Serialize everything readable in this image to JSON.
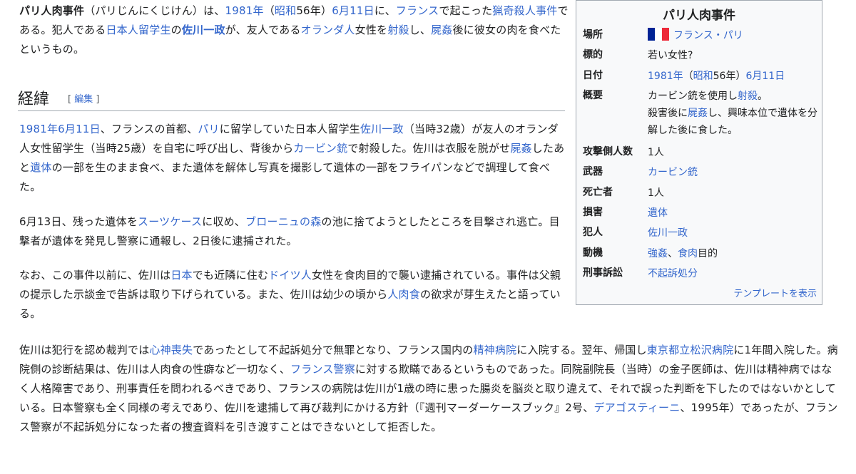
{
  "intro": {
    "bold_title": "パリ人肉事件",
    "reading": "（パリじんにくじけん）は、",
    "year_link": "1981年",
    "paren_open": "（",
    "era_link": "昭和",
    "era_year": "56年）",
    "date_link": "6月11日",
    "t1": "に、",
    "france_link": "フランス",
    "t2": "で起こった",
    "crime_link": "猟奇殺人事件",
    "t3": "である。犯人である",
    "student_link": "日本人留学生",
    "t4": "の",
    "culprit_link": "佐川一政",
    "t5": "が、友人である",
    "dutch_link": "オランダ人",
    "t6": "女性を",
    "shot_link": "射殺",
    "t7": "し、",
    "necro_link": "屍姦",
    "t8": "後に彼女の肉を食べたというもの。"
  },
  "section": {
    "title": "経緯",
    "edit_open": "[",
    "edit_label": "編集",
    "edit_close": "]"
  },
  "p1": {
    "date_link": "1981年6月11日",
    "a": "、フランスの首都、",
    "paris_link": "パリ",
    "b": "に留学していた日本人留学生",
    "sagawa_link": "佐川一政",
    "c": "（当時32歳）が友人のオランダ人女性留学生（当時25歳）を自宅に呼び出し、背後から",
    "carbine_link": "カービン銃",
    "d": "で射殺した。佐川は衣服を脱がせ",
    "necro_link": "屍姦",
    "e": "したあと",
    "corpse_link": "遺体",
    "f": "の一部を生のまま食べ、また遺体を解体し写真を撮影して遺体の一部をフライパンなどで調理して食べた。"
  },
  "p2": {
    "a": "6月13日、残った遺体を",
    "suitcase_link": "スーツケース",
    "b": "に収め、",
    "bois_link": "ブローニュの森",
    "c": "の池に捨てようとしたところを目撃され逃亡。目撃者が遺体を発見し警察に通報し、2日後に逮捕された。"
  },
  "p3": {
    "a": "なお、この事件以前に、佐川は",
    "japan_link": "日本",
    "b": "でも近隣に住む",
    "german_link": "ドイツ人",
    "c": "女性を食肉目的で襲い逮捕されている。事件は父親の提示した示談金で告訴は取り下げられている。また、佐川は幼少の頃から",
    "canni_link": "人肉食",
    "d": "の欲求が芽生えたと語っている。"
  },
  "p4": {
    "a": "佐川は犯行を認め裁判では",
    "insanity_link": "心神喪失",
    "b": "であったとして不起訴処分で無罪となり、フランス国内の",
    "hospital_link": "精神病院",
    "c": "に入院する。翌年、帰国し",
    "matsuzawa_link": "東京都立松沢病院",
    "d": "に1年間入院した。病院側の診断結果は、佐川は人肉食の性癖など一切なく、",
    "police_link": "フランス警察",
    "e": "に対する欺瞞であるというものであった。同院副院長（当時）の金子医師は、佐川は精神病ではなく人格障害であり、刑事責任を問われるべきであり、フランスの病院は佐川が1歳の時に患った腸炎を脳炎と取り違えて、それで誤った判断を下したのではないかとしている。日本警察も全く同様の考えであり、佐川を逮捕して再び裁判にかける方針（『週刊マーダーケースブック』2号、",
    "deagostini_link": "デアゴスティーニ",
    "f": "、1995年）であったが、フランス警察が不起訴処分になった者の捜査資料を引き渡すことはできないとして拒否した。"
  },
  "infobox": {
    "title": "パリ人肉事件",
    "place_label": "場所",
    "place_value": "フランス・パリ",
    "flag_colors": [
      "#002395",
      "#ffffff",
      "#ed2939"
    ],
    "target_label": "標的",
    "target_value": "若い女性?",
    "date_label": "日付",
    "date_year": "1981年",
    "date_open": "（",
    "date_era": "昭和",
    "date_era_year": "56年）",
    "date_day": "6月11日",
    "summary_label": "概要",
    "summary_a": "カービン銃を使用し",
    "summary_shot": "射殺",
    "summary_b": "。",
    "summary_c": "殺害後に",
    "summary_necro": "屍姦",
    "summary_d": "し、興味本位で遺体を分解した後に食した。",
    "attackers_label": "攻撃側人数",
    "attackers_value": "1人",
    "weapon_label": "武器",
    "weapon_value": "カービン銃",
    "dead_label": "死亡者",
    "dead_value": "1人",
    "damage_label": "損害",
    "damage_value": "遺体",
    "culprit_label": "犯人",
    "culprit_value": "佐川一政",
    "motive_label": "動機",
    "motive_a": "強姦",
    "motive_sep": "、",
    "motive_b": "食肉",
    "motive_c": "目的",
    "trial_label": "刑事訴訟",
    "trial_value": "不起訴処分",
    "template_link": "テンプレートを表示"
  },
  "colors": {
    "link": "#3366cc",
    "text": "#202122",
    "infobox_bg": "#f8f9fa",
    "border": "#a2a9b1"
  }
}
